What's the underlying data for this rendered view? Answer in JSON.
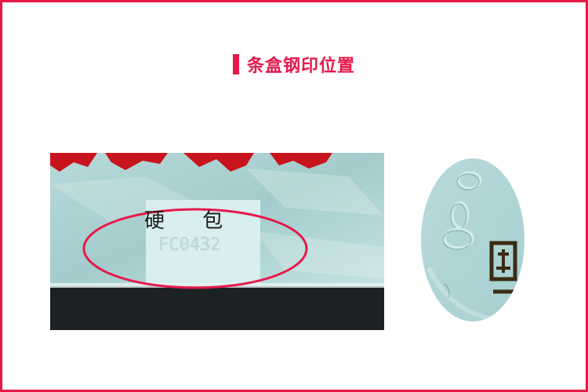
{
  "header": {
    "title": "条盒钢印位置",
    "accent_color": "#e6194b"
  },
  "main_photo": {
    "label": "硬 包"
  },
  "colors": {
    "package": "#a9cfd1",
    "label_panel": "#d9eeee",
    "base": "#1c2124",
    "highlight_ring": "#e6194b"
  }
}
